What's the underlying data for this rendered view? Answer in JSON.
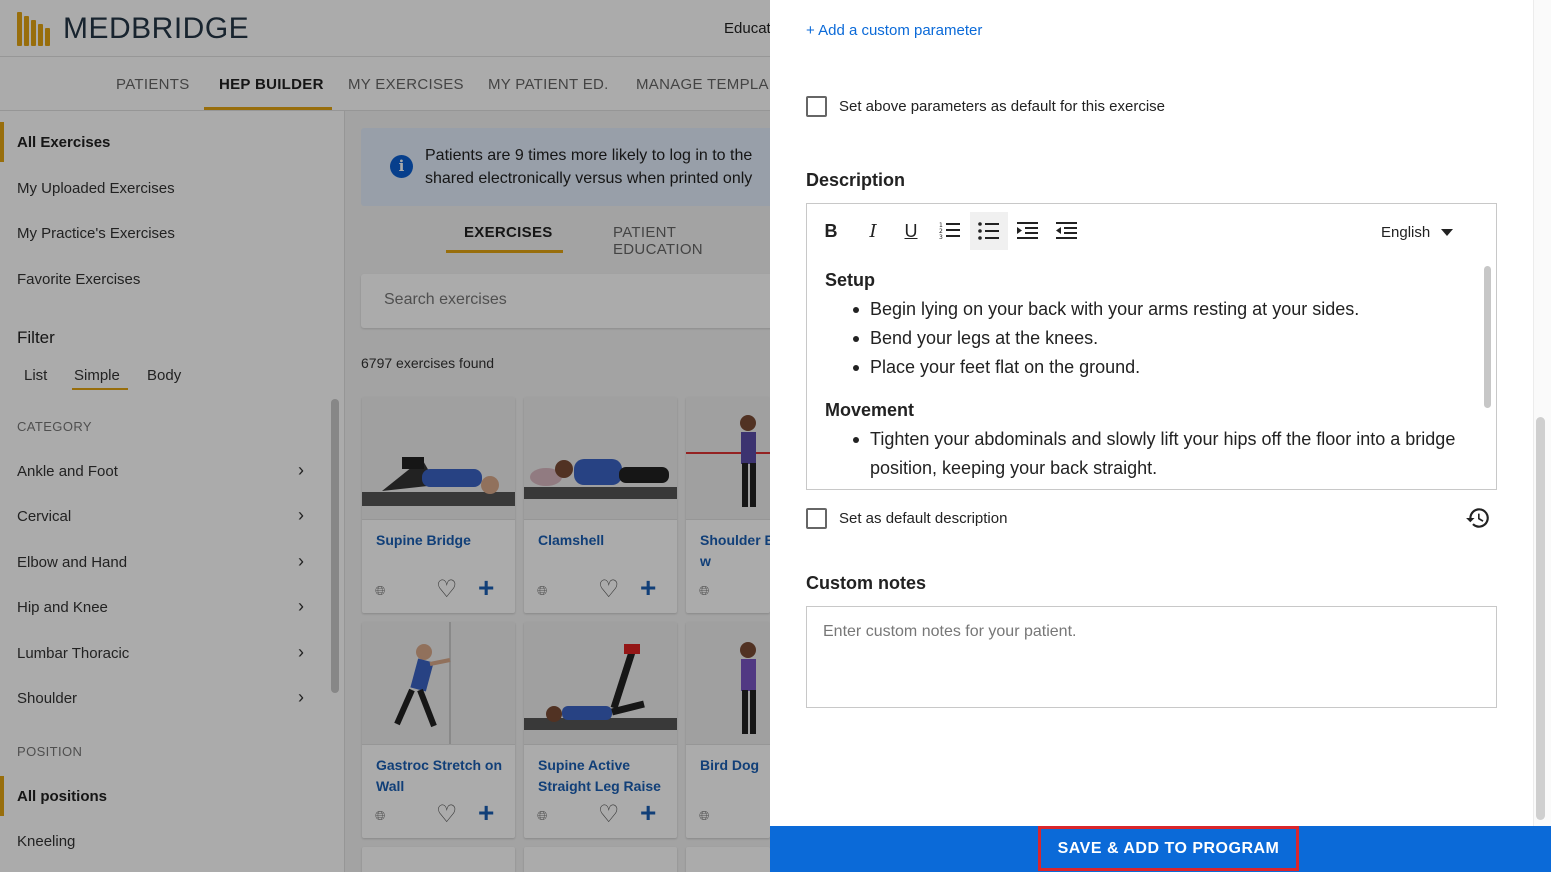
{
  "header": {
    "logo_text": "MEDBRIDGE",
    "top_right_text": "Educat"
  },
  "nav": {
    "tabs": [
      {
        "label": "PATIENTS"
      },
      {
        "label": "HEP BUILDER"
      },
      {
        "label": "MY EXERCISES"
      },
      {
        "label": "MY PATIENT ED."
      },
      {
        "label": "MANAGE TEMPLA"
      }
    ],
    "active_tab": "HEP BUILDER"
  },
  "sidebar": {
    "library_items": [
      {
        "label": "All Exercises"
      },
      {
        "label": "My Uploaded Exercises"
      },
      {
        "label": "My Practice's Exercises"
      },
      {
        "label": "Favorite Exercises"
      }
    ],
    "filter_heading": "Filter",
    "filter_tabs": [
      {
        "label": "List"
      },
      {
        "label": "Simple"
      },
      {
        "label": "Body"
      }
    ],
    "category_caption": "CATEGORY",
    "categories": [
      {
        "label": "Ankle and Foot"
      },
      {
        "label": "Cervical"
      },
      {
        "label": "Elbow and Hand"
      },
      {
        "label": "Hip and Knee"
      },
      {
        "label": "Lumbar Thoracic"
      },
      {
        "label": "Shoulder"
      }
    ],
    "position_caption": "POSITION",
    "positions": [
      {
        "label": "All positions"
      },
      {
        "label": "Kneeling"
      }
    ]
  },
  "main": {
    "banner_line1": "Patients are 9 times more likely to log in to the",
    "banner_line2": "shared electronically versus when printed only",
    "subtabs": [
      {
        "label": "EXERCISES"
      },
      {
        "label": "PATIENT EDUCATION"
      }
    ],
    "search_placeholder": "Search exercises",
    "count_text": "6797 exercises found",
    "cards": [
      {
        "title": "Supine Bridge"
      },
      {
        "title": "Clamshell"
      },
      {
        "title": "Shoulder E Rotation w"
      },
      {
        "title": "Gastroc Stretch on Wall"
      },
      {
        "title": "Supine Active Straight Leg Raise"
      },
      {
        "title": "Bird Dog"
      }
    ]
  },
  "drawer": {
    "add_param_link": "+ Add a custom parameter",
    "default_params_label": "Set above parameters as default for this exercise",
    "description_title": "Description",
    "toolbar": {
      "bold": "B",
      "italic": "I",
      "underline": "U",
      "language": "English"
    },
    "description": {
      "setup_head": "Setup",
      "setup_items": [
        "Begin lying on your back with your arms resting at your sides.",
        "Bend your legs at the knees.",
        "Place your feet flat on the ground."
      ],
      "movement_head": "Movement",
      "movement_items": [
        "Tighten your abdominals and slowly lift your hips off the floor into a bridge position, keeping your back straight."
      ]
    },
    "default_desc_label": "Set as default description",
    "custom_notes_title": "Custom notes",
    "notes_placeholder": "Enter custom notes for your patient.",
    "save_button": "SAVE & ADD TO PROGRAM"
  },
  "colors": {
    "accent": "#e3a413",
    "link": "#0b6ad8",
    "footer": "#0b6ad8",
    "highlight_border": "#d9262c"
  }
}
